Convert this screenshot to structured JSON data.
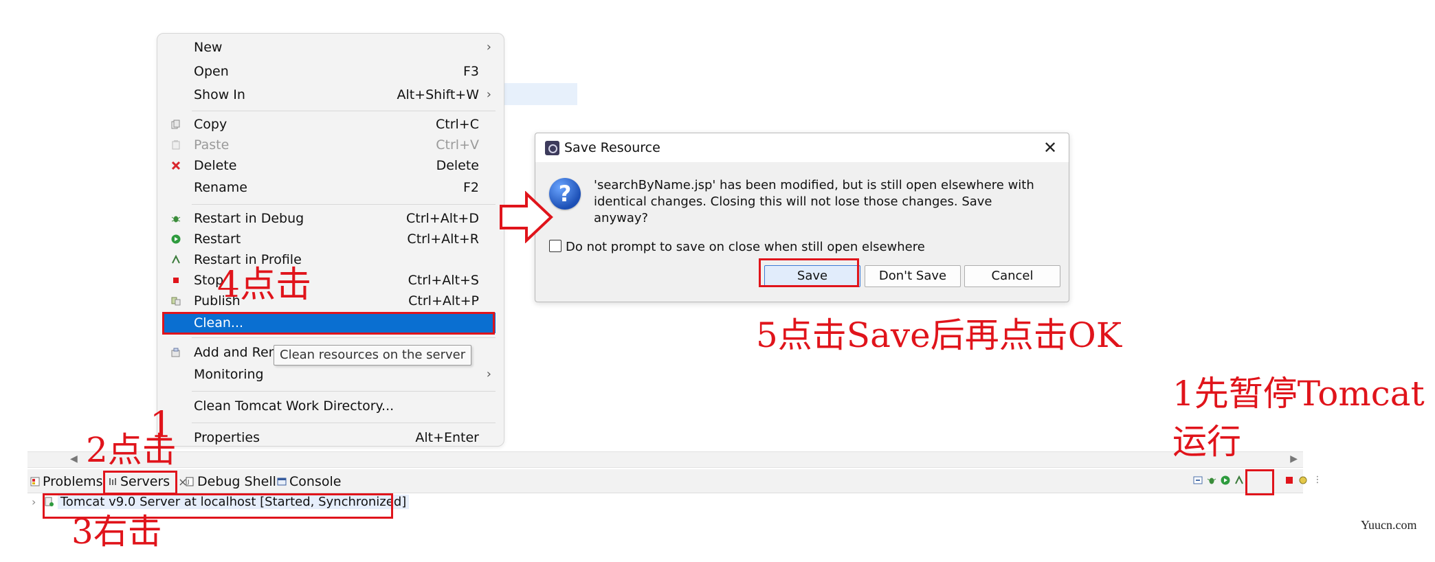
{
  "context_menu": {
    "items": [
      {
        "label": "New",
        "shortcut": "",
        "submenu": true
      },
      {
        "label": "Open",
        "shortcut": "F3"
      },
      {
        "label": "Show In",
        "shortcut": "Alt+Shift+W",
        "submenu": true
      },
      {
        "label": "Copy",
        "shortcut": "Ctrl+C"
      },
      {
        "label": "Paste",
        "shortcut": "Ctrl+V",
        "disabled": true
      },
      {
        "label": "Delete",
        "shortcut": "Delete"
      },
      {
        "label": "Rename",
        "shortcut": "F2"
      },
      {
        "label": "Restart in Debug",
        "shortcut": "Ctrl+Alt+D"
      },
      {
        "label": "Restart",
        "shortcut": "Ctrl+Alt+R"
      },
      {
        "label": "Restart in Profile",
        "shortcut": ""
      },
      {
        "label": "Stop",
        "shortcut": "Ctrl+Alt+S"
      },
      {
        "label": "Publish",
        "shortcut": "Ctrl+Alt+P"
      },
      {
        "label": "Clean...",
        "shortcut": "",
        "selected": true
      },
      {
        "label": "Add and Rem",
        "shortcut": ""
      },
      {
        "label": "Monitoring",
        "shortcut": "",
        "submenu": true
      },
      {
        "label": "Clean Tomcat Work Directory...",
        "shortcut": ""
      },
      {
        "label": "Properties",
        "shortcut": "Alt+Enter"
      }
    ],
    "submenu_glyph": "›",
    "tooltip": "Clean resources on the server"
  },
  "dialog": {
    "title": "Save Resource",
    "close_glyph": "✕",
    "icon_glyph": "?",
    "message": "'searchByName.jsp' has been modified, but is still open elsewhere with identical changes. Closing this will not lose those changes. Save anyway?",
    "checkbox_label": "Do not prompt to save on close when still open elsewhere",
    "checkbox_checked": false,
    "buttons": {
      "save": "Save",
      "dont_save": "Don't Save",
      "cancel": "Cancel"
    }
  },
  "panel": {
    "tabs": {
      "problems": "Problems",
      "servers": "Servers",
      "servers_close": "×",
      "debug_shell": "Debug Shell",
      "console": "Console"
    },
    "server_row": {
      "expander": "›",
      "label": "Tomcat v9.0 Server at localhost  [Started, Synchronized]"
    },
    "scroll_left": "◀",
    "scroll_right": "▶"
  },
  "annotations": {
    "step1_line1": "1先暂停Tomcat",
    "step1_line2": "运行",
    "step2": "2点击",
    "step3": "3右击",
    "step4": "4点击",
    "step5": "5点击Save后再点击OK",
    "mark_1": "1"
  },
  "watermark": "Yuucn.com",
  "colors": {
    "annotation_red": "#e0141b",
    "menu_selection": "#0a6fd1",
    "primary_button_fill": "#e1ecfb"
  }
}
